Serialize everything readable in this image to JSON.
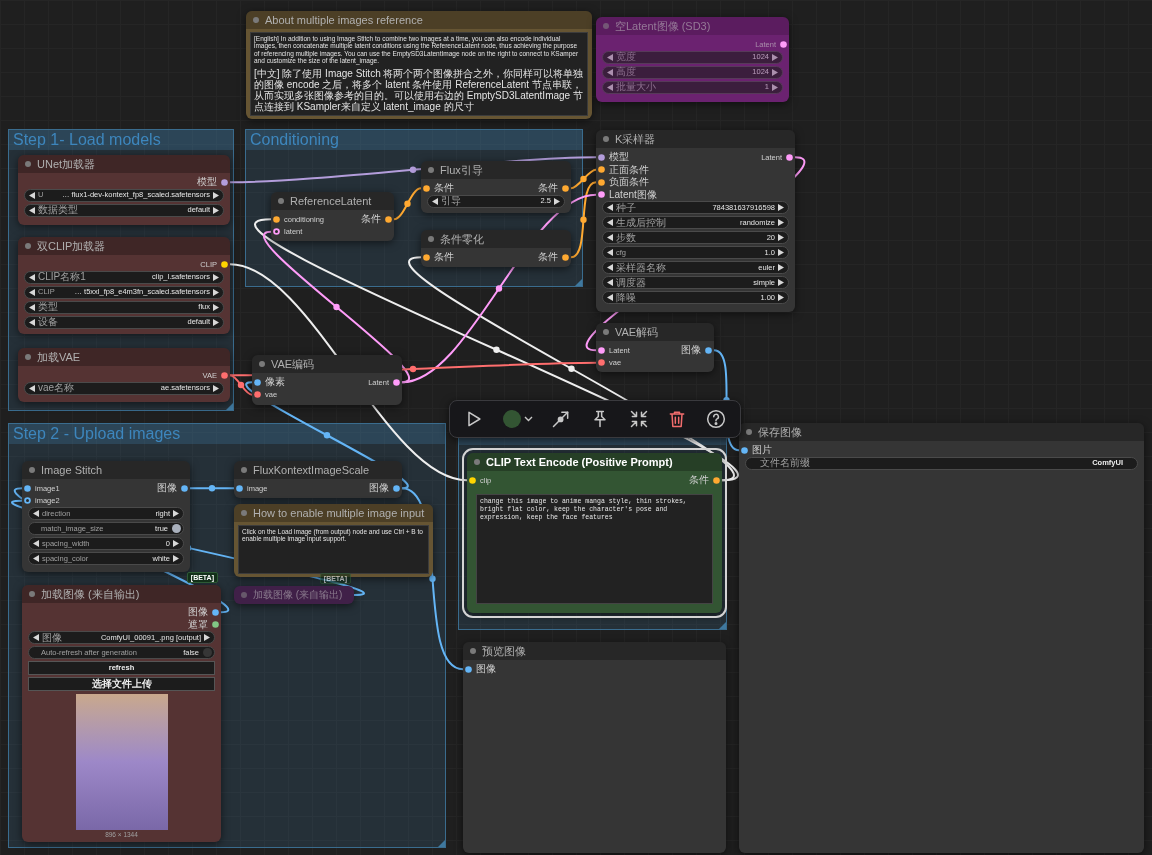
{
  "groups": [
    {
      "kind": "titled",
      "title": "Step 1- Load models"
    },
    {
      "kind": "titled",
      "title": "Conditioning"
    },
    {
      "kind": "titled",
      "title": "Step 2 - Upload images"
    },
    {
      "kind": "untitled"
    }
  ],
  "nodes": [
    {
      "kind": "note",
      "title": "About multiple images reference",
      "color": "#665533",
      "bypassed": false,
      "selected": false,
      "paragraphs": [
        "[English] In addition to using Image Stitch to combine two images at a time, you can also encode individual images, then concatenate multiple latent conditions using the ReferenceLatent node, thus achieving the purpose of referencing multiple images. You can use the EmptySD3LatentImage node on the right to connect to KSamper and customize the size of the latent_image.",
        "[中文] 除了使用 Image Stitch 将两个两个图像拼合之外，你同样可以将单独的图像 encode 之后，将多个 latent 条件使用 ReferenceLatent 节点串联，从而实现多张图像参考的目的。可以使用右边的 EmptySD3LatentImage 节点连接到 KSampler来自定义 latent_image 的尺寸"
      ]
    },
    {
      "kind": "node",
      "title": "空Latent图像 (SD3)",
      "color": "#6b2270",
      "bypassed": true,
      "selected": false,
      "outputs": [
        {
          "label": "Latent",
          "color": "#ff9cf9"
        }
      ],
      "widgets": [
        {
          "kind": "number",
          "label": "宽度",
          "value": "1024"
        },
        {
          "kind": "number",
          "label": "高度",
          "value": "1024"
        },
        {
          "kind": "number",
          "label": "批量大小",
          "value": "1"
        }
      ]
    },
    {
      "kind": "node",
      "title": "UNet加载器",
      "color": "#553333",
      "bypassed": false,
      "selected": false,
      "outputs": [
        {
          "label": "模型",
          "color": "#b39ddb"
        }
      ],
      "widgets": [
        {
          "kind": "combo",
          "label": "U",
          "value": "… flux1-dev-kontext_fp8_scaled.safetensors"
        },
        {
          "kind": "combo",
          "label": "数据类型",
          "value": "default"
        }
      ]
    },
    {
      "kind": "node",
      "title": "双CLIP加载器",
      "color": "#553333",
      "bypassed": false,
      "selected": false,
      "outputs": [
        {
          "label": "CLIP",
          "color": "#ffd500"
        }
      ],
      "widgets": [
        {
          "kind": "combo",
          "label": "CLIP名称1",
          "value": "clip_l.safetensors"
        },
        {
          "kind": "combo",
          "label": "CLIP",
          "value": "… t5xxl_fp8_e4m3fn_scaled.safetensors"
        },
        {
          "kind": "combo",
          "label": "类型",
          "value": "flux"
        },
        {
          "kind": "combo",
          "label": "设备",
          "value": "default"
        }
      ]
    },
    {
      "kind": "node",
      "title": "加载VAE",
      "color": "#553333",
      "bypassed": false,
      "selected": false,
      "outputs": [
        {
          "label": "VAE",
          "color": "#ff6e6e"
        }
      ],
      "widgets": [
        {
          "kind": "combo",
          "label": "vae名称",
          "value": "ae.safetensors"
        }
      ]
    },
    {
      "kind": "node",
      "title": "ReferenceLatent",
      "color": "#353535",
      "bypassed": false,
      "selected": false,
      "inputs": [
        {
          "label": "conditioning",
          "color": "#ffa931",
          "optional": false
        },
        {
          "label": "latent",
          "color": "#ff9cf9",
          "optional": true
        }
      ],
      "outputs": [
        {
          "label": "条件",
          "color": "#ffa931"
        }
      ]
    },
    {
      "kind": "node",
      "title": "Flux引导",
      "color": "#353535",
      "bypassed": false,
      "selected": false,
      "inputs": [
        {
          "label": "条件",
          "color": "#ffa931",
          "optional": false
        }
      ],
      "outputs": [
        {
          "label": "条件",
          "color": "#ffa931"
        }
      ],
      "widgets": [
        {
          "kind": "number",
          "label": "引导",
          "value": "2.5"
        }
      ]
    },
    {
      "kind": "node",
      "title": "条件零化",
      "color": "#353535",
      "bypassed": false,
      "selected": false,
      "inputs": [
        {
          "label": "条件",
          "color": "#ffa931",
          "optional": false
        }
      ],
      "outputs": [
        {
          "label": "条件",
          "color": "#ffa931"
        }
      ]
    },
    {
      "kind": "node",
      "title": "K采样器",
      "color": "#353535",
      "bypassed": false,
      "selected": false,
      "inputs": [
        {
          "label": "模型",
          "color": "#b39ddb",
          "optional": false
        },
        {
          "label": "正面条件",
          "color": "#ffa931",
          "optional": false
        },
        {
          "label": "负面条件",
          "color": "#ffa931",
          "optional": false
        },
        {
          "label": "Latent图像",
          "color": "#ff9cf9",
          "optional": false
        }
      ],
      "outputs": [
        {
          "label": "Latent",
          "color": "#ff9cf9"
        }
      ],
      "widgets": [
        {
          "kind": "number",
          "label": "种子",
          "value": "784381637916598"
        },
        {
          "kind": "combo",
          "label": "生成后控制",
          "value": "randomize"
        },
        {
          "kind": "number",
          "label": "步数",
          "value": "20"
        },
        {
          "kind": "number",
          "label": "cfg",
          "value": "1.0"
        },
        {
          "kind": "combo",
          "label": "采样器名称",
          "value": "euler"
        },
        {
          "kind": "combo",
          "label": "调度器",
          "value": "simple"
        },
        {
          "kind": "number",
          "label": "降噪",
          "value": "1.00"
        }
      ]
    },
    {
      "kind": "node",
      "title": "VAE编码",
      "color": "#353535",
      "bypassed": false,
      "selected": false,
      "inputs": [
        {
          "label": "像素",
          "color": "#64b5f6",
          "optional": false
        },
        {
          "label": "vae",
          "color": "#ff6e6e",
          "optional": false
        }
      ],
      "outputs": [
        {
          "label": "Latent",
          "color": "#ff9cf9"
        }
      ]
    },
    {
      "kind": "node",
      "title": "VAE解码",
      "color": "#353535",
      "bypassed": false,
      "selected": false,
      "inputs": [
        {
          "label": "Latent",
          "color": "#ff9cf9",
          "optional": false
        },
        {
          "label": "vae",
          "color": "#ff6e6e",
          "optional": false
        }
      ],
      "outputs": [
        {
          "label": "图像",
          "color": "#64b5f6"
        }
      ]
    },
    {
      "kind": "node",
      "title": "Image Stitch",
      "color": "#353535",
      "bypassed": false,
      "selected": false,
      "inputs": [
        {
          "label": "image1",
          "color": "#64b5f6",
          "optional": false
        },
        {
          "label": "image2",
          "color": "#64b5f6",
          "optional": true
        }
      ],
      "outputs": [
        {
          "label": "图像",
          "color": "#64b5f6"
        }
      ],
      "widgets": [
        {
          "kind": "combo",
          "label": "direction",
          "value": "right"
        },
        {
          "kind": "toggle",
          "label": "match_image_size",
          "value": "true",
          "on": true
        },
        {
          "kind": "number",
          "label": "spacing_width",
          "value": "0"
        },
        {
          "kind": "combo",
          "label": "spacing_color",
          "value": "white"
        }
      ]
    },
    {
      "kind": "node",
      "title": "FluxKontextImageScale",
      "color": "#353535",
      "bypassed": false,
      "selected": false,
      "inputs": [
        {
          "label": "image",
          "color": "#64b5f6",
          "optional": false
        }
      ],
      "outputs": [
        {
          "label": "图像",
          "color": "#64b5f6"
        }
      ]
    },
    {
      "kind": "note",
      "title": "How to enable multiple image input",
      "color": "#665533",
      "bypassed": false,
      "selected": false,
      "paragraphs": [
        "Click on the Load image (from output) node and use Ctrl + B to enable multiple image input support."
      ]
    },
    {
      "kind": "node",
      "title": "加载图像 (来自输出)",
      "color": "#553333",
      "bypassed": false,
      "selected": false,
      "badge": "[BETA]",
      "outputs": [
        {
          "label": "图像",
          "color": "#64b5f6"
        },
        {
          "label": "遮罩",
          "color": "#81c784"
        }
      ],
      "widgets": [
        {
          "kind": "combo",
          "label": "图像",
          "value": "ComfyUI_00091_.png [output]"
        },
        {
          "kind": "toggle",
          "label": "Auto-refresh after generation",
          "value": "false",
          "on": false
        },
        {
          "kind": "button",
          "label": "refresh"
        },
        {
          "kind": "button",
          "label": "选择文件上传"
        },
        {
          "kind": "image",
          "caption": "896 × 1344"
        }
      ]
    },
    {
      "kind": "collapsed",
      "title": "加载图像 (来自输出)",
      "color": "#4c2655",
      "bypassed": true,
      "selected": false,
      "badge": "[BETA]"
    },
    {
      "kind": "node",
      "title": "CLIP Text Encode (Positive Prompt)",
      "color": "#335533",
      "bypassed": false,
      "selected": true,
      "inputs": [
        {
          "label": "clip",
          "color": "#ffd500",
          "optional": false
        }
      ],
      "outputs": [
        {
          "label": "条件",
          "color": "#ffa931"
        }
      ],
      "widgets": [
        {
          "kind": "textarea",
          "value": "change this image to anime manga style, thin strokes, bright flat color, keep the character's pose and expression, keep the face features"
        }
      ]
    },
    {
      "kind": "node",
      "title": "保存图像",
      "color": "#353535",
      "bypassed": false,
      "selected": false,
      "inputs": [
        {
          "label": "图片",
          "color": "#64b5f6",
          "optional": false
        }
      ],
      "widgets": [
        {
          "kind": "text",
          "label": "文件名前缀",
          "value": "ComfyUI"
        }
      ]
    },
    {
      "kind": "node",
      "title": "预览图像",
      "color": "#353535",
      "bypassed": false,
      "selected": false,
      "inputs": [
        {
          "label": "图像",
          "color": "#64b5f6",
          "optional": false
        }
      ]
    }
  ],
  "toolbar": {
    "buttons": [
      {
        "kind": "run"
      },
      {
        "kind": "color"
      },
      {
        "kind": "bypass"
      },
      {
        "kind": "pin"
      },
      {
        "kind": "collapse"
      },
      {
        "kind": "delete"
      },
      {
        "kind": "help"
      }
    ]
  }
}
